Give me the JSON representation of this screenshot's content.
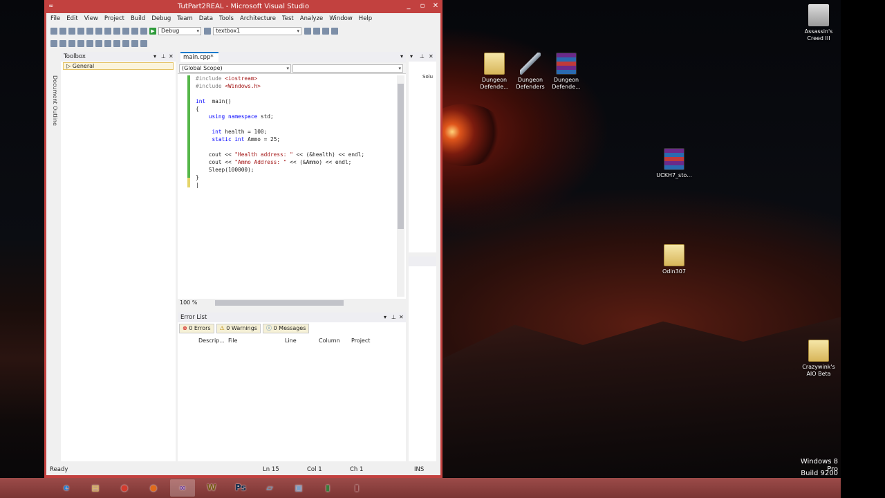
{
  "window": {
    "title": "TutPart2REAL - Microsoft Visual Studio",
    "status": {
      "ready": "Ready",
      "line": "Ln 15",
      "col": "Col 1",
      "ch": "Ch 1",
      "mode": "INS"
    }
  },
  "menu": [
    "File",
    "Edit",
    "View",
    "Project",
    "Build",
    "Debug",
    "Team",
    "Data",
    "Tools",
    "Architecture",
    "Test",
    "Analyze",
    "Window",
    "Help"
  ],
  "toolbar": {
    "config": "Debug",
    "find": "textbox1"
  },
  "toolbox": {
    "title": "Toolbox",
    "group": "General",
    "side_tab": "Document Outline"
  },
  "editor": {
    "tab": "main.cpp*",
    "scope": "(Global Scope)",
    "zoom": "100 %"
  },
  "code": [
    [
      [
        "pp",
        "#include "
      ],
      [
        "str",
        "<iostream>"
      ]
    ],
    [
      [
        "pp",
        "#include "
      ],
      [
        "str",
        "<Windows.h>"
      ]
    ],
    [],
    [
      [
        "kw",
        "int"
      ],
      [
        "",
        "  main()"
      ]
    ],
    [
      [
        "",
        "{"
      ]
    ],
    [
      [
        "",
        "    "
      ],
      [
        "kw",
        "using"
      ],
      [
        "",
        ""
      ],
      [
        "kw",
        " namespace"
      ],
      [
        "",
        " std;"
      ]
    ],
    [],
    [
      [
        "",
        "     "
      ],
      [
        "kw",
        "int"
      ],
      [
        "",
        " health = 100;"
      ]
    ],
    [
      [
        "",
        "     "
      ],
      [
        "kw",
        "static"
      ],
      [
        "",
        " "
      ],
      [
        "kw",
        "int"
      ],
      [
        "",
        " Ammo = 25;"
      ]
    ],
    [],
    [
      [
        "",
        "    cout << "
      ],
      [
        "str",
        "\"Health address: \""
      ],
      [
        "",
        " << (&health) << endl;"
      ]
    ],
    [
      [
        "",
        "    cout << "
      ],
      [
        "str",
        "\"Ammo Address: \""
      ],
      [
        "",
        " << (&Ammo) << endl;"
      ]
    ],
    [
      [
        "",
        "    Sleep(100000);"
      ]
    ],
    [
      [
        "",
        "}"
      ]
    ],
    [
      [
        "",
        "|"
      ]
    ]
  ],
  "errorlist": {
    "title": "Error List",
    "errors": "0 Errors",
    "warnings": "0 Warnings",
    "messages": "0 Messages",
    "columns": [
      "Descrip...",
      "File",
      "Line",
      "Column",
      "Project"
    ]
  },
  "solution": {
    "label": "Solu"
  },
  "desktop": {
    "icons": [
      {
        "label": "Assassin's Creed III",
        "kind": "ac"
      },
      {
        "label": "Dungeon Defende...",
        "kind": "folder"
      },
      {
        "label": "Dungeon Defenders",
        "kind": "sword"
      },
      {
        "label": "Dungeon Defende...",
        "kind": "rar"
      },
      {
        "label": "UCKH7_sto...",
        "kind": "rar"
      },
      {
        "label": "Odin307",
        "kind": "folder"
      },
      {
        "label": "Crazywink's AIO Beta",
        "kind": "folder"
      }
    ],
    "winver": "Windows 8 Pro",
    "build": "Build 9200"
  },
  "taskbar": [
    {
      "name": "internet-explorer",
      "glyph": "e",
      "color": "#1e7fd6"
    },
    {
      "name": "file-explorer",
      "glyph": "▤",
      "color": "#e2c25a"
    },
    {
      "name": "chrome",
      "glyph": "●",
      "color": "#d23b2e"
    },
    {
      "name": "firefox",
      "glyph": "●",
      "color": "#e06a1a"
    },
    {
      "name": "visual-studio",
      "glyph": "∞",
      "color": "#6a3aa0"
    },
    {
      "name": "wow",
      "glyph": "W",
      "color": "#7a5a1a"
    },
    {
      "name": "photoshop",
      "glyph": "Ps",
      "color": "#0c2a4a"
    },
    {
      "name": "app-generic",
      "glyph": "▱",
      "color": "#5aa0c8"
    },
    {
      "name": "image-viewer",
      "glyph": "▣",
      "color": "#7aa0c8"
    },
    {
      "name": "app-green",
      "glyph": "▮",
      "color": "#3a7a3a"
    },
    {
      "name": "app-red",
      "glyph": "▮",
      "color": "#8a3a3a"
    }
  ]
}
